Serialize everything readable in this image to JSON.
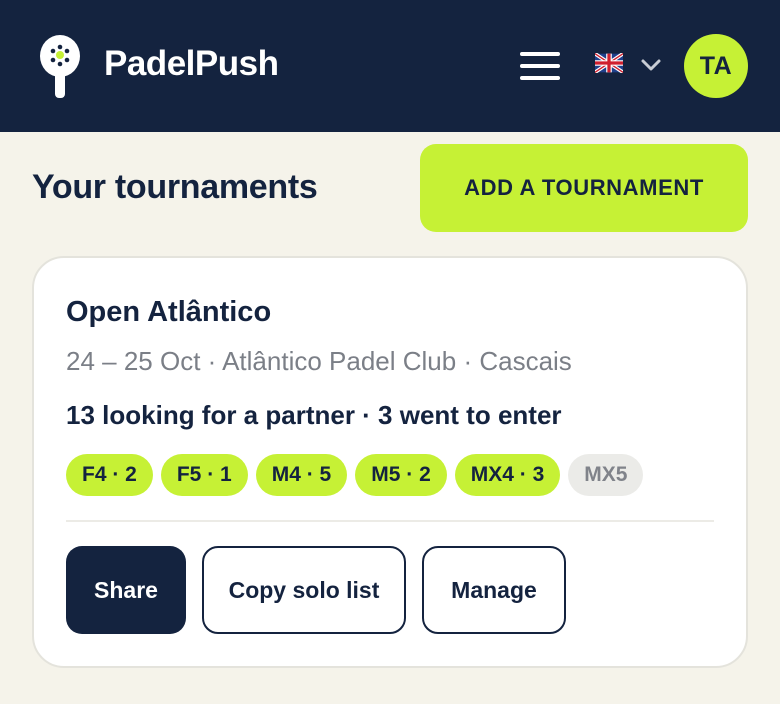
{
  "header": {
    "brand": "PadelPush",
    "avatar_initials": "TA",
    "language_flag": "uk-flag-icon",
    "icons": {
      "logo": "padel-racket-icon",
      "menu": "hamburger-menu-icon",
      "dropdown": "chevron-down-icon"
    }
  },
  "main": {
    "title": "Your tournaments",
    "add_button": "ADD A TOURNAMENT"
  },
  "tournament": {
    "name": "Open Atlântico",
    "meta": "24 – 25 Oct · Atlântico Padel Club · Cascais",
    "summary": "13 looking for a partner · 3 went to enter",
    "categories": [
      {
        "label": "F4 · 2",
        "active": true
      },
      {
        "label": "F5 · 1",
        "active": true
      },
      {
        "label": "M4 · 5",
        "active": true
      },
      {
        "label": "M5 · 2",
        "active": true
      },
      {
        "label": "MX4 · 3",
        "active": true
      },
      {
        "label": "MX5",
        "active": false
      }
    ],
    "actions": {
      "share": "Share",
      "copy": "Copy solo list",
      "manage": "Manage"
    }
  },
  "colors": {
    "navy": "#14233f",
    "lime": "#c6f135",
    "background": "#f5f3ea",
    "muted": "#7b7f87"
  }
}
